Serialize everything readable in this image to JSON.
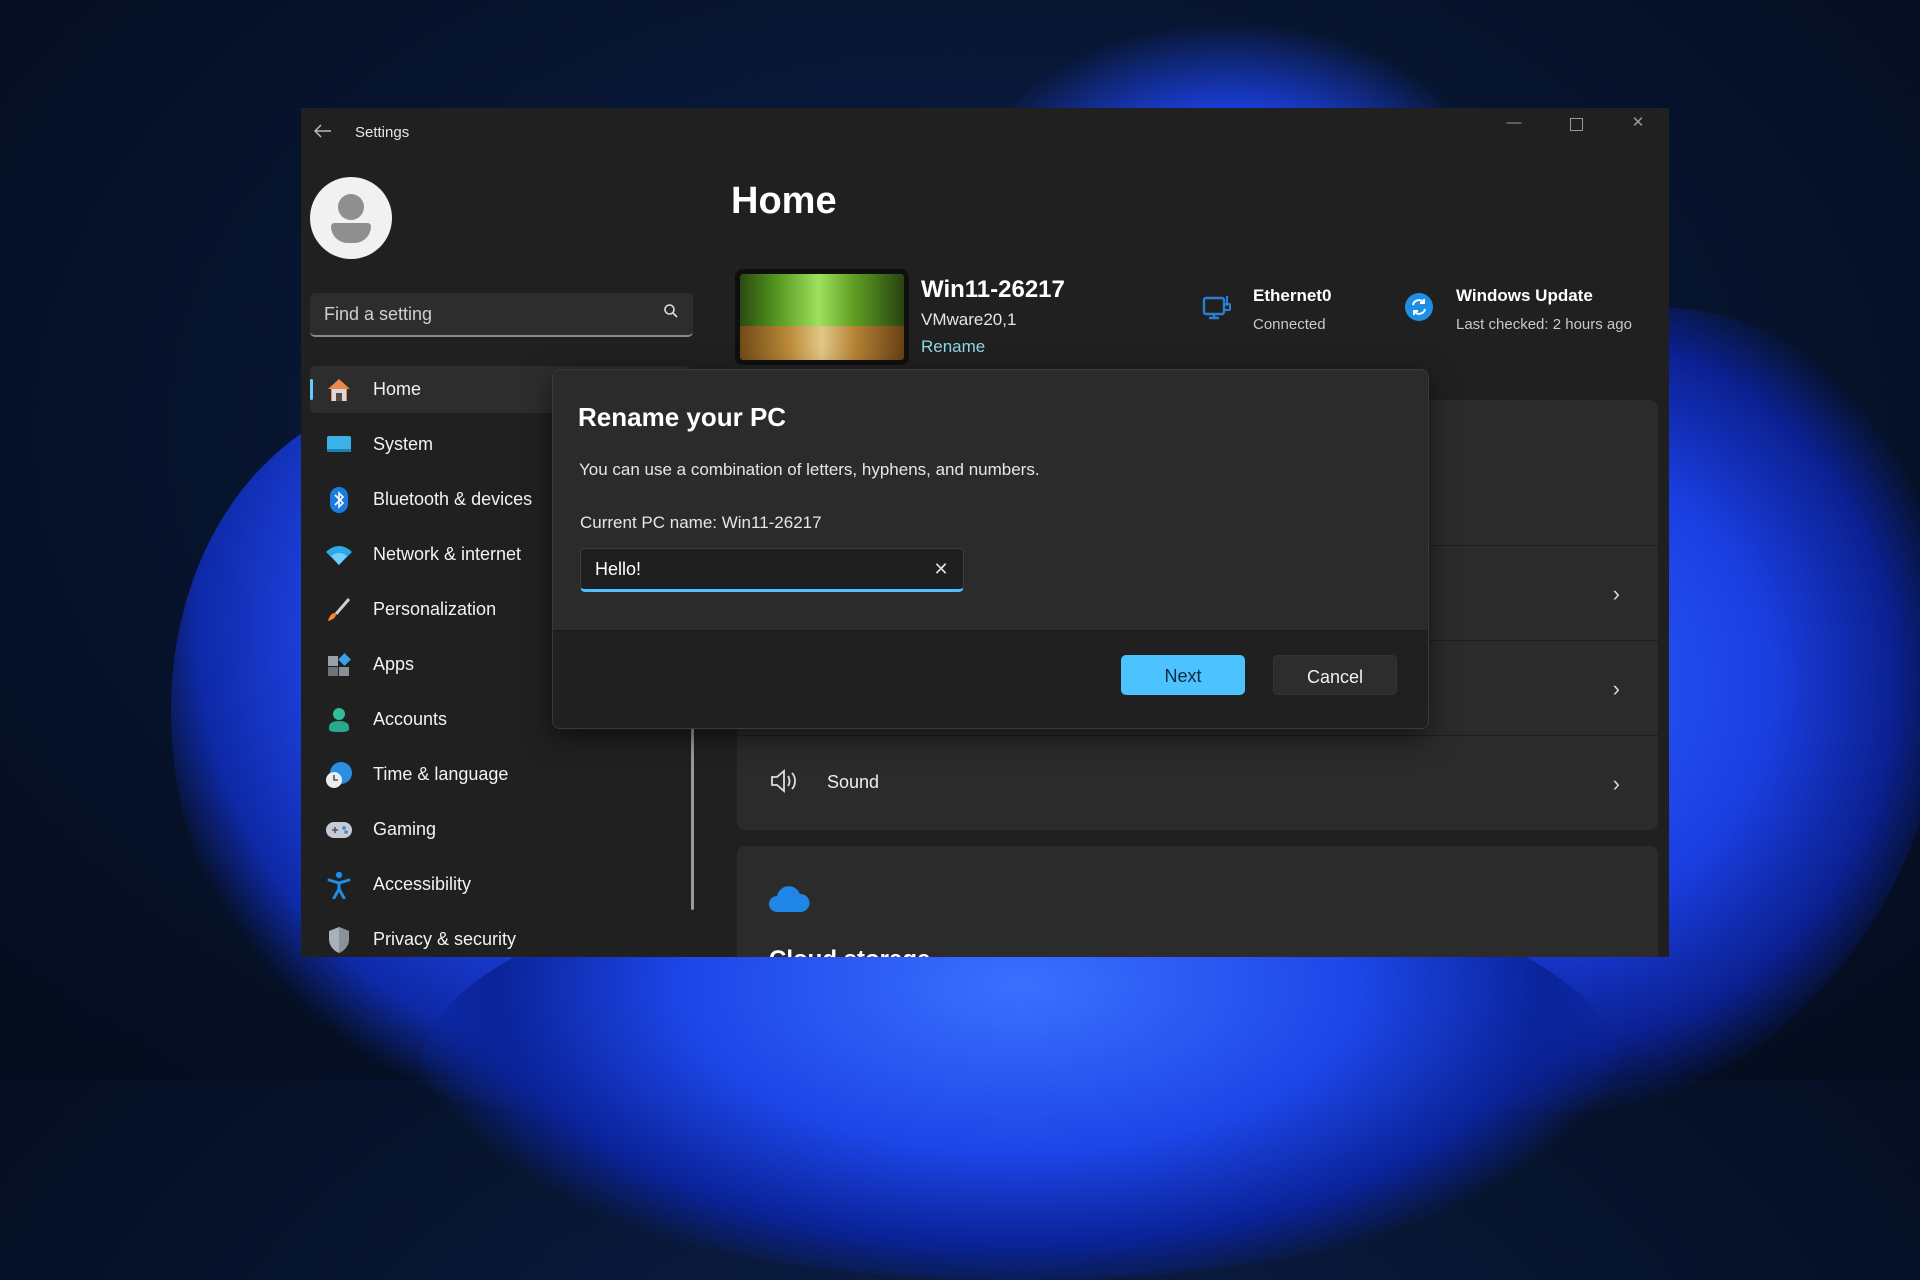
{
  "window": {
    "title": "Settings",
    "controls": {
      "minimize": "minimize",
      "maximize": "maximize",
      "close": "close"
    }
  },
  "search": {
    "placeholder": "Find a setting"
  },
  "sidebar": {
    "items": [
      {
        "label": "Home",
        "icon": "home-icon",
        "active": true
      },
      {
        "label": "System",
        "icon": "system-icon"
      },
      {
        "label": "Bluetooth & devices",
        "icon": "bluetooth-icon"
      },
      {
        "label": "Network & internet",
        "icon": "wifi-icon"
      },
      {
        "label": "Personalization",
        "icon": "brush-icon"
      },
      {
        "label": "Apps",
        "icon": "apps-icon"
      },
      {
        "label": "Accounts",
        "icon": "accounts-icon"
      },
      {
        "label": "Time & language",
        "icon": "time-language-icon"
      },
      {
        "label": "Gaming",
        "icon": "gaming-icon"
      },
      {
        "label": "Accessibility",
        "icon": "accessibility-icon"
      },
      {
        "label": "Privacy & security",
        "icon": "shield-icon"
      }
    ]
  },
  "main": {
    "title": "Home",
    "device": {
      "name": "Win11-26217",
      "model": "VMware20,1",
      "rename_link": "Rename"
    },
    "status": {
      "network": {
        "title": "Ethernet0",
        "subtitle": "Connected"
      },
      "update": {
        "title": "Windows Update",
        "subtitle": "Last checked: 2 hours ago"
      }
    },
    "cards": {
      "sound_label": "Sound",
      "cloud_title": "Cloud storage"
    }
  },
  "dialog": {
    "title": "Rename your PC",
    "description": "You can use a combination of letters, hyphens, and numbers.",
    "current_name": "Current PC name: Win11-26217",
    "input_value": "Hello!",
    "next_label": "Next",
    "cancel_label": "Cancel"
  },
  "colors": {
    "accent": "#4cc2ff",
    "link": "#8fd6e6",
    "window_bg": "#202020",
    "card_bg": "#2b2b2b"
  }
}
